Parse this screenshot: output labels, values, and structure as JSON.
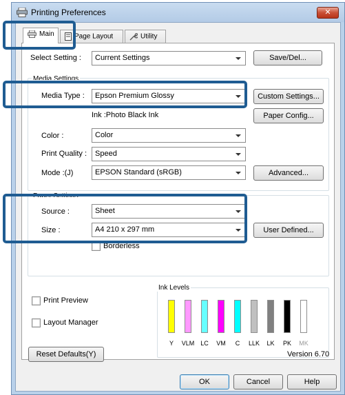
{
  "window": {
    "title": "Printing Preferences",
    "close_glyph": "✕"
  },
  "tabs": [
    {
      "label": "Main",
      "icon": "printer-icon"
    },
    {
      "label": "Page Layout",
      "icon": "page-icon"
    },
    {
      "label": "Utility",
      "icon": "wrench-icon"
    }
  ],
  "select_setting": {
    "label": "Select Setting :",
    "value": "Current Settings",
    "button": "Save/Del..."
  },
  "media_settings": {
    "group_label": "Media Settings",
    "media_type_label": "Media Type :",
    "media_type_value": "Epson Premium Glossy",
    "custom_settings_button": "Custom Settings...",
    "ink_text": "Ink :Photo Black Ink",
    "paper_config_button": "Paper Config...",
    "color_label": "Color :",
    "color_value": "Color",
    "print_quality_label": "Print Quality :",
    "print_quality_value": "Speed",
    "mode_label": "Mode :(J)",
    "mode_value": "EPSON Standard (sRGB)",
    "advanced_button": "Advanced..."
  },
  "paper_settings": {
    "group_label": "Paper Settings",
    "source_label": "Source :",
    "source_value": "Sheet",
    "size_label": "Size :",
    "size_value": "A4 210 x 297 mm",
    "user_defined_button": "User Defined...",
    "borderless_label": "Borderless"
  },
  "options": {
    "print_preview_label": "Print Preview",
    "layout_manager_label": "Layout Manager"
  },
  "ink_levels": {
    "label": "Ink Levels",
    "inks": [
      {
        "name": "Y",
        "color": "#ffff00",
        "level": 1.0
      },
      {
        "name": "VLM",
        "color": "#ff99ff",
        "level": 1.0
      },
      {
        "name": "LC",
        "color": "#66ffff",
        "level": 1.0
      },
      {
        "name": "VM",
        "color": "#ff00ff",
        "level": 1.0
      },
      {
        "name": "C",
        "color": "#00ffff",
        "level": 1.0
      },
      {
        "name": "LLK",
        "color": "#c0c0c0",
        "level": 1.0
      },
      {
        "name": "LK",
        "color": "#808080",
        "level": 1.0
      },
      {
        "name": "PK",
        "color": "#000000",
        "level": 1.0
      },
      {
        "name": "MK",
        "color": "#000000",
        "level": 0.0
      }
    ]
  },
  "footer": {
    "reset_button": "Reset Defaults(Y)",
    "version": "Version 6.70"
  },
  "dialog_buttons": {
    "ok": "OK",
    "cancel": "Cancel",
    "help": "Help"
  }
}
